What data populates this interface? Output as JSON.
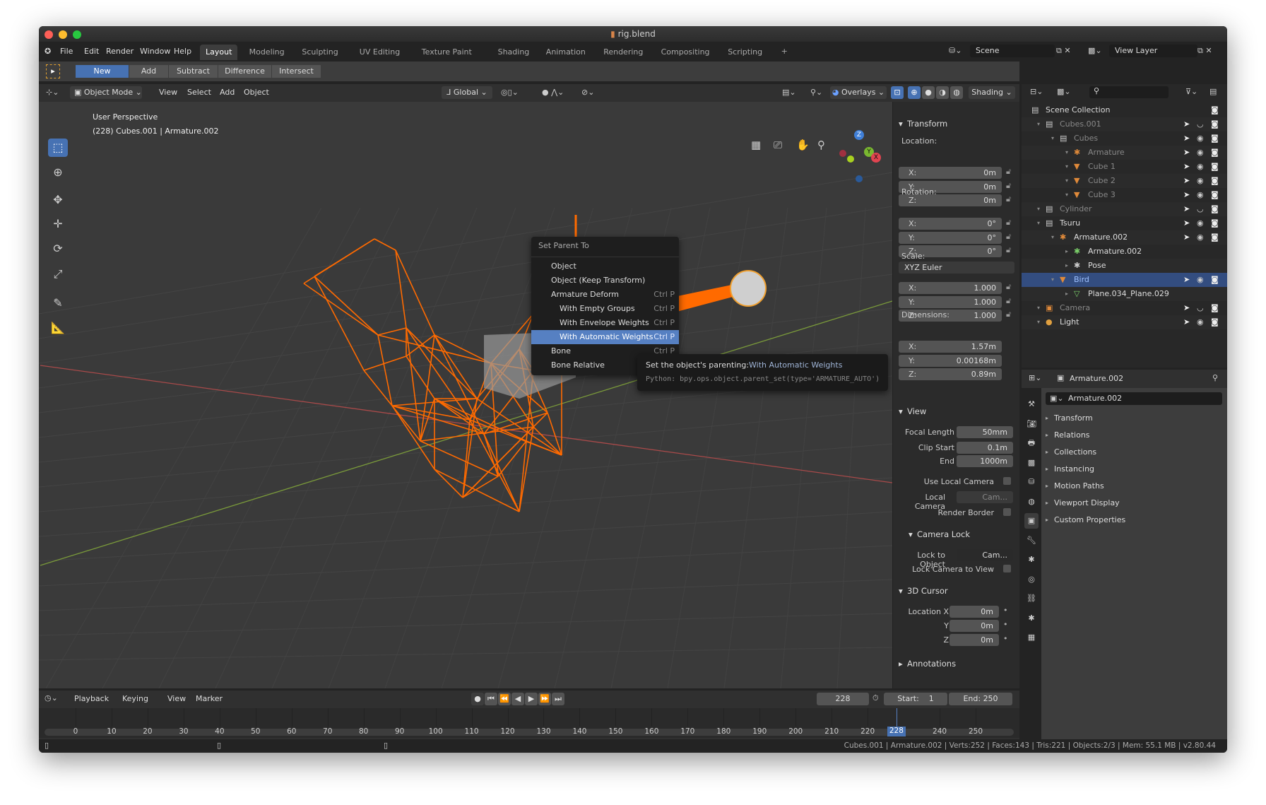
{
  "window": {
    "title": "rig.blend",
    "file_icon": "blend-file-icon"
  },
  "menubar": {
    "items": [
      "File",
      "Edit",
      "Render",
      "Window",
      "Help"
    ],
    "workspaces": [
      "Layout",
      "Modeling",
      "Sculpting",
      "UV Editing",
      "Texture Paint",
      "Shading",
      "Animation",
      "Rendering",
      "Compositing",
      "Scripting"
    ],
    "active_workspace": "Layout",
    "add_tab": "+",
    "scene": "Scene",
    "view_layer": "View Layer"
  },
  "toolheader": {
    "modes": [
      "New",
      "Add",
      "Subtract",
      "Difference",
      "Intersect"
    ],
    "active": "New"
  },
  "viewport_header": {
    "mode": "Object Mode",
    "menus": [
      "View",
      "Select",
      "Add",
      "Object"
    ],
    "orientation": "Global",
    "overlays": "Overlays",
    "shading": "Shading"
  },
  "viewport": {
    "perspective": "User Perspective",
    "info": "(228) Cubes.001 | Armature.002",
    "colors": {
      "bird": "#ff6a00",
      "x_axis": "#a84a4a",
      "y_axis": "#7a9a3a",
      "background": "#3a3a3a"
    },
    "gizmo": {
      "z": "Z",
      "y": "Y",
      "x": "X"
    }
  },
  "context_menu": {
    "title": "Set Parent To",
    "items": [
      {
        "label": "Object",
        "shortcut": ""
      },
      {
        "label": "Object (Keep Transform)",
        "shortcut": ""
      },
      {
        "label": "Armature Deform",
        "shortcut": "Ctrl P"
      },
      {
        "label": "With Empty Groups",
        "shortcut": "Ctrl P"
      },
      {
        "label": "With Envelope Weights",
        "shortcut": "Ctrl P"
      },
      {
        "label": "With Automatic Weights",
        "shortcut": "Ctrl P",
        "selected": true
      },
      {
        "label": "Bone",
        "shortcut": "Ctrl P"
      },
      {
        "label": "Bone Relative",
        "shortcut": ""
      }
    ]
  },
  "tooltip": {
    "label": "Set the object's parenting:",
    "value": "With Automatic Weights",
    "python": "Python: bpy.ops.object.parent_set(type='ARMATURE_AUTO')"
  },
  "sidebar": {
    "transform": {
      "title": "Transform",
      "location_label": "Location:",
      "location": [
        "0m",
        "0m",
        "0m"
      ],
      "rotation_label": "Rotation:",
      "rotation": [
        "0°",
        "0°",
        "0°"
      ],
      "rotation_mode": "XYZ Euler",
      "scale_label": "Scale:",
      "scale": [
        "1.000",
        "1.000",
        "1.000"
      ],
      "dimensions_label": "Dimensions:",
      "dimensions": [
        "1.57m",
        "0.00168m",
        "0.89m"
      ],
      "axes": [
        "X:",
        "Y:",
        "Z:"
      ]
    },
    "view": {
      "title": "View",
      "focal_length_label": "Focal Length",
      "focal_length": "50mm",
      "clip_start_label": "Clip Start",
      "clip_start": "0.1m",
      "clip_end_label": "End",
      "clip_end": "1000m",
      "use_local_camera": "Use Local Camera",
      "local_camera_label": "Local Camera",
      "local_camera": "Cam...",
      "render_border": "Render Border",
      "camera_lock": "Camera Lock",
      "lock_to_object_label": "Lock to Object",
      "lock_to_object": "Cam...",
      "lock_camera_to_view": "Lock Camera to View"
    },
    "cursor": {
      "title": "3D Cursor",
      "x_label": "Location X",
      "y_label": "Y",
      "z_label": "Z",
      "values": [
        "0m",
        "0m",
        "0m"
      ]
    },
    "annotations": {
      "title": "Annotations"
    }
  },
  "outliner": {
    "rows": [
      {
        "label": "Scene Collection",
        "icon": "collection-icon",
        "depth": 0,
        "dim": false
      },
      {
        "label": "Cubes.001",
        "icon": "collection-icon",
        "depth": 1,
        "dim": true,
        "vis": "hidden"
      },
      {
        "label": "Cubes",
        "icon": "collection-icon",
        "depth": 2,
        "dim": true
      },
      {
        "label": "Armature",
        "icon": "armature-icon",
        "depth": 3,
        "dim": true
      },
      {
        "label": "Cube 1",
        "icon": "mesh-icon",
        "depth": 3,
        "dim": true
      },
      {
        "label": "Cube 2",
        "icon": "mesh-icon",
        "depth": 3,
        "dim": true
      },
      {
        "label": "Cube 3",
        "icon": "mesh-icon",
        "depth": 3,
        "dim": true
      },
      {
        "label": "Cylinder",
        "icon": "collection-icon",
        "depth": 1,
        "dim": true,
        "vis": "hidden"
      },
      {
        "label": "Tsuru",
        "icon": "collection-icon",
        "depth": 1,
        "dim": false
      },
      {
        "label": "Armature.002",
        "icon": "armature-icon",
        "depth": 2,
        "dim": false
      },
      {
        "label": "Armature.002",
        "icon": "armature-data-icon",
        "depth": 3,
        "dim": false,
        "novis": true
      },
      {
        "label": "Pose",
        "icon": "pose-icon",
        "depth": 3,
        "dim": false,
        "novis": true
      },
      {
        "label": "Bird",
        "icon": "mesh-icon",
        "depth": 2,
        "dim": false,
        "selected": true
      },
      {
        "label": "Plane.034_Plane.029",
        "icon": "mesh-data-icon",
        "depth": 3,
        "dim": false,
        "novis": true
      },
      {
        "label": "Camera",
        "icon": "camera-icon",
        "depth": 1,
        "dim": true,
        "vis": "hidden"
      },
      {
        "label": "Light",
        "icon": "light-icon",
        "depth": 1,
        "dim": false
      }
    ]
  },
  "properties": {
    "object_name": "Armature.002",
    "data_name": "Armature.002",
    "sections": [
      "Transform",
      "Relations",
      "Collections",
      "Instancing",
      "Motion Paths",
      "Viewport Display",
      "Custom Properties"
    ]
  },
  "timeline": {
    "menus": [
      "Playback",
      "Keying",
      "View",
      "Marker"
    ],
    "current_frame": "228",
    "start_label": "Start:",
    "start": "1",
    "end_label": "End:",
    "end": "250",
    "ticks": [
      "0",
      "10",
      "20",
      "30",
      "40",
      "50",
      "60",
      "70",
      "80",
      "90",
      "100",
      "110",
      "120",
      "130",
      "140",
      "150",
      "160",
      "170",
      "180",
      "190",
      "200",
      "210",
      "220",
      "240",
      "250"
    ]
  },
  "status": {
    "text": "Cubes.001 | Armature.002 | Verts:252 | Faces:143 | Tris:221 | Objects:2/3 | Mem: 55.1 MB | v2.80.44"
  }
}
